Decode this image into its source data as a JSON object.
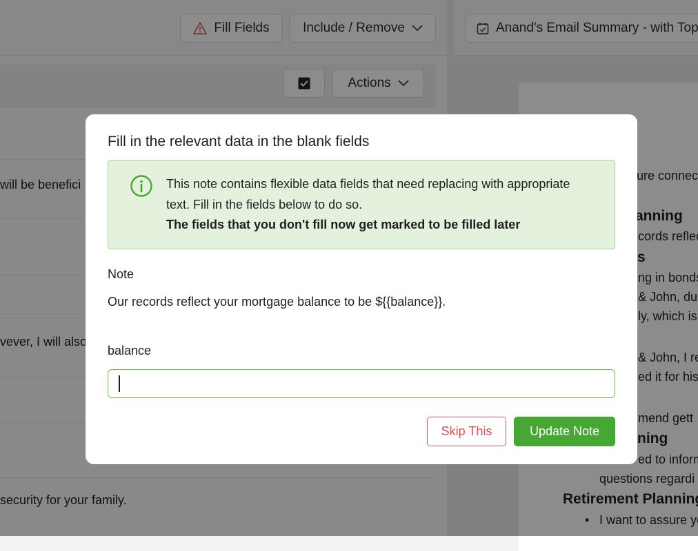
{
  "header": {
    "fill_fields_label": "Fill Fields",
    "include_remove_label": "Include / Remove",
    "email_summary_label": "Anand's Email Summary - with Topic"
  },
  "toolbar": {
    "actions_label": "Actions"
  },
  "background_left": {
    "rows": [
      " will be benefici",
      "vever, I will also",
      " security for your family."
    ]
  },
  "background_right": {
    "lines": [
      "ure connec",
      "anning",
      "cords reflec",
      "s",
      "ng in bonds",
      "& John, dur",
      "ly, which is",
      "& John, I re",
      "ed it for his",
      "mend gett",
      "ning",
      "ed to inform",
      "questions regardi",
      "Retirement Planning",
      "I want to assure yo"
    ]
  },
  "modal": {
    "title": "Fill in the relevant data in the blank fields",
    "info": {
      "line1": "This note contains flexible data fields that need replacing with appropriate",
      "line2": "text. Fill in the fields below to do so.",
      "line3": "The fields that you don't fill now get marked to be filled later"
    },
    "note_label": "Note",
    "note_text": "Our records reflect your mortgage balance to be ${{balance}}.",
    "field_label": "balance",
    "field_value": "",
    "skip_label": "Skip This",
    "update_label": "Update Note"
  },
  "colors": {
    "accent_green": "#46a832",
    "danger_red": "#e05050",
    "info_bg": "#e3f1dd"
  },
  "icons": {
    "warning": "warning-triangle-icon",
    "chevron": "chevron-down-icon",
    "checkbox": "checkbox-checked-icon",
    "calendar": "calendar-check-icon",
    "info": "info-circle-icon"
  }
}
